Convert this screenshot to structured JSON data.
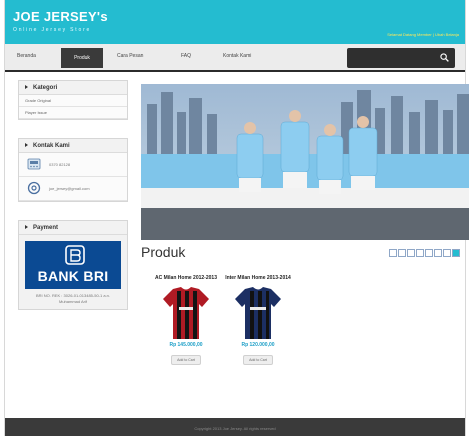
{
  "header": {
    "title": "JOE JERSEY's",
    "subtitle": "Online Jersey Store",
    "links": "Selamat Datang Member | Ubah Belanja"
  },
  "nav": {
    "items": [
      "Beranda",
      "Produk",
      "Cara Pesan",
      "FAQ",
      "Kontak Kami"
    ],
    "active": "Produk"
  },
  "search": {
    "icon": "search-icon"
  },
  "sidebar": {
    "kategori": {
      "title": "Kategori",
      "items": [
        "Grade Original",
        "Player Issue"
      ]
    },
    "kontak": {
      "title": "Kontak Kami",
      "phone": "0370 82128",
      "email": "joe_jersey@gmail.com"
    },
    "payment": {
      "title": "Payment",
      "bank_name": "BANK BRI",
      "info": "BRI NO. REK : 3026-01-013485-50-1 a.n. Muhammad Arif"
    }
  },
  "main": {
    "section_title": "Produk",
    "pager": {
      "pages": 8,
      "current": 8
    },
    "products": [
      {
        "name": "AC Milan Home 2012-2013",
        "price": "Rp 145.000,00",
        "button": "Add to Cart",
        "colors": [
          "#b01b24",
          "#141414"
        ]
      },
      {
        "name": "Inter Milan Home 2013-2014",
        "price": "Rp 120.000,00",
        "button": "Add to Cart",
        "colors": [
          "#1c2f63",
          "#111111"
        ]
      }
    ]
  },
  "footer": {
    "text": "Copyright 2013 Joe Jersey. All rights reserved"
  },
  "colors": {
    "header": "#24bcd0",
    "nav_active": "#3a3a3a",
    "price": "#1d9fc7",
    "bank": "#0b4a93"
  }
}
